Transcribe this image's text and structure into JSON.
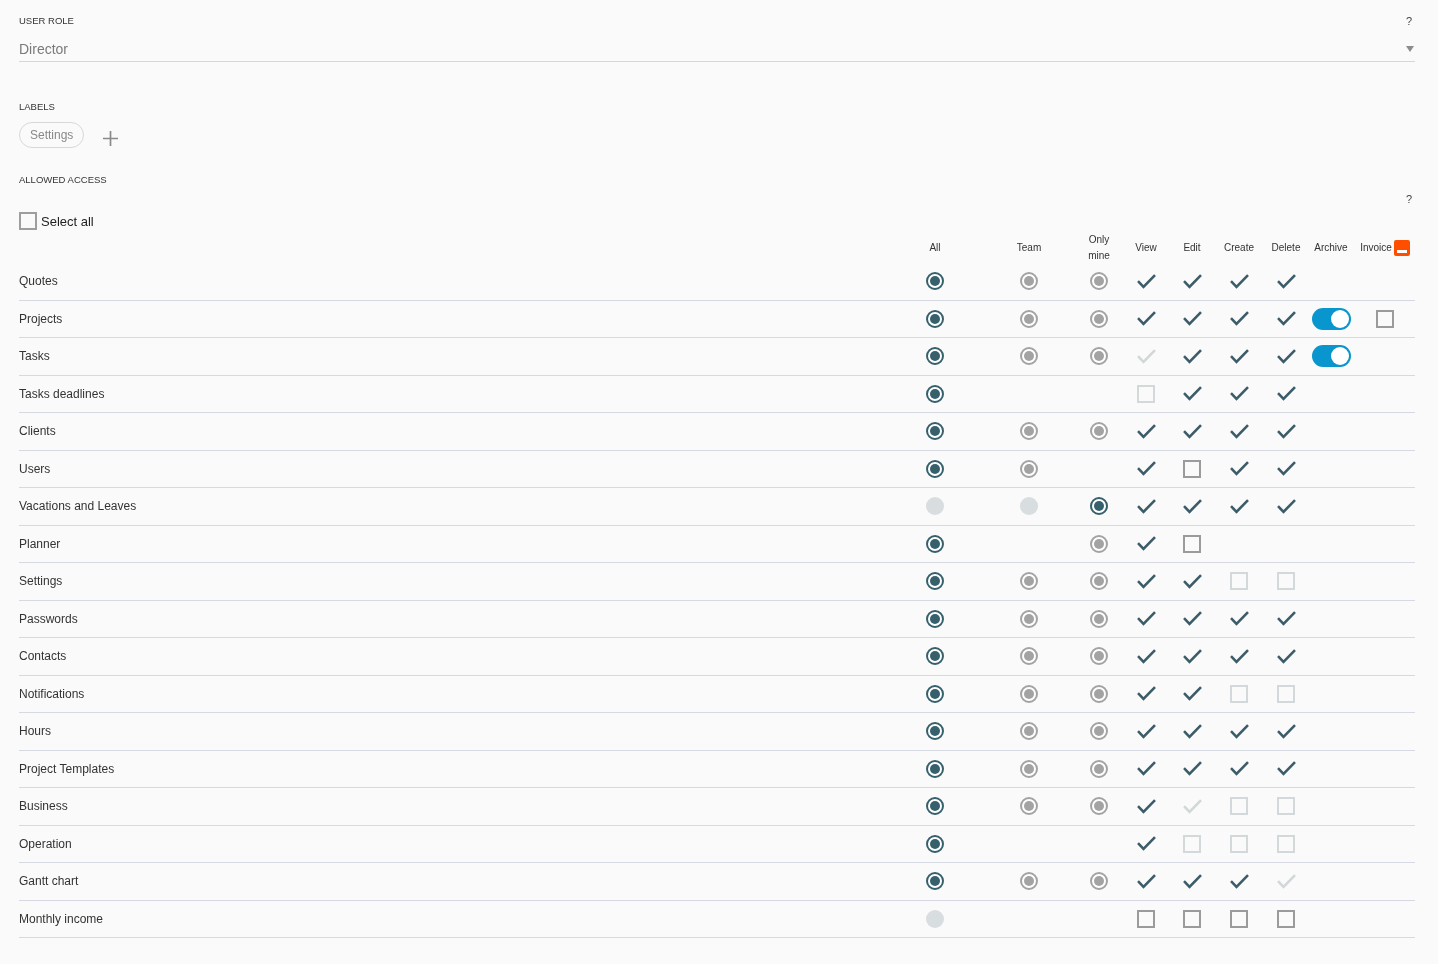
{
  "user_role": {
    "label": "USER ROLE",
    "help": "?",
    "value": "Director"
  },
  "labels": {
    "label": "LABELS",
    "chips": [
      "Settings"
    ]
  },
  "allowed_access": {
    "label": "ALLOWED ACCESS",
    "help": "?",
    "select_all": {
      "label": "Select all",
      "checked": false
    },
    "columns": [
      {
        "label": "All",
        "kind": "radio"
      },
      {
        "label": "Team",
        "kind": "radio"
      },
      {
        "label": "Only mine",
        "kind": "radio"
      },
      {
        "label": "View",
        "kind": "check"
      },
      {
        "label": "Edit",
        "kind": "check"
      },
      {
        "label": "Create",
        "kind": "check"
      },
      {
        "label": "Delete",
        "kind": "check"
      },
      {
        "label": "Archive",
        "kind": "toggle"
      },
      {
        "label": "Invoice",
        "kind": "check",
        "icon": true
      }
    ],
    "rows": [
      {
        "name": "Quotes",
        "cells": [
          {
            "selected": true,
            "disabled": false
          },
          {
            "selected": true,
            "disabled": true
          },
          {
            "selected": true,
            "disabled": true
          },
          {
            "checked": true,
            "disabled": false
          },
          {
            "checked": true,
            "disabled": false
          },
          {
            "checked": true,
            "disabled": false
          },
          {
            "checked": true,
            "disabled": false
          },
          null,
          null
        ]
      },
      {
        "name": "Projects",
        "cells": [
          {
            "selected": true,
            "disabled": false
          },
          {
            "selected": true,
            "disabled": true
          },
          {
            "selected": true,
            "disabled": true
          },
          {
            "checked": true,
            "disabled": false
          },
          {
            "checked": true,
            "disabled": false
          },
          {
            "checked": true,
            "disabled": false
          },
          {
            "checked": true,
            "disabled": false
          },
          {
            "on": true
          },
          {
            "checked": false,
            "disabled": false
          }
        ]
      },
      {
        "name": "Tasks",
        "cells": [
          {
            "selected": true,
            "disabled": false
          },
          {
            "selected": true,
            "disabled": true
          },
          {
            "selected": true,
            "disabled": true
          },
          {
            "checked": true,
            "disabled": true
          },
          {
            "checked": true,
            "disabled": false
          },
          {
            "checked": true,
            "disabled": false
          },
          {
            "checked": true,
            "disabled": false
          },
          {
            "on": true
          },
          null
        ]
      },
      {
        "name": "Tasks deadlines",
        "cells": [
          {
            "selected": true,
            "disabled": false
          },
          null,
          null,
          {
            "checked": false,
            "disabled": true
          },
          {
            "checked": true,
            "disabled": false
          },
          {
            "checked": true,
            "disabled": false
          },
          {
            "checked": true,
            "disabled": false
          },
          null,
          null
        ]
      },
      {
        "name": "Clients",
        "cells": [
          {
            "selected": true,
            "disabled": false
          },
          {
            "selected": true,
            "disabled": true
          },
          {
            "selected": true,
            "disabled": true
          },
          {
            "checked": true,
            "disabled": false
          },
          {
            "checked": true,
            "disabled": false
          },
          {
            "checked": true,
            "disabled": false
          },
          {
            "checked": true,
            "disabled": false
          },
          null,
          null
        ]
      },
      {
        "name": "Users",
        "cells": [
          {
            "selected": true,
            "disabled": false
          },
          {
            "selected": true,
            "disabled": true
          },
          null,
          {
            "checked": true,
            "disabled": false
          },
          {
            "checked": false,
            "disabled": false
          },
          {
            "checked": true,
            "disabled": false
          },
          {
            "checked": true,
            "disabled": false
          },
          null,
          null
        ]
      },
      {
        "name": "Vacations and Leaves",
        "cells": [
          {
            "selected": false,
            "disabled": true
          },
          {
            "selected": false,
            "disabled": true
          },
          {
            "selected": true,
            "disabled": false
          },
          {
            "checked": true,
            "disabled": false
          },
          {
            "checked": true,
            "disabled": false
          },
          {
            "checked": true,
            "disabled": false
          },
          {
            "checked": true,
            "disabled": false
          },
          null,
          null
        ]
      },
      {
        "name": "Planner",
        "cells": [
          {
            "selected": true,
            "disabled": false
          },
          null,
          {
            "selected": true,
            "disabled": true
          },
          {
            "checked": true,
            "disabled": false
          },
          {
            "checked": false,
            "disabled": false
          },
          null,
          null,
          null,
          null
        ]
      },
      {
        "name": "Settings",
        "cells": [
          {
            "selected": true,
            "disabled": false
          },
          {
            "selected": true,
            "disabled": true
          },
          {
            "selected": true,
            "disabled": true
          },
          {
            "checked": true,
            "disabled": false
          },
          {
            "checked": true,
            "disabled": false
          },
          {
            "checked": false,
            "disabled": true
          },
          {
            "checked": false,
            "disabled": true
          },
          null,
          null
        ]
      },
      {
        "name": "Passwords",
        "cells": [
          {
            "selected": true,
            "disabled": false
          },
          {
            "selected": true,
            "disabled": true
          },
          {
            "selected": true,
            "disabled": true
          },
          {
            "checked": true,
            "disabled": false
          },
          {
            "checked": true,
            "disabled": false
          },
          {
            "checked": true,
            "disabled": false
          },
          {
            "checked": true,
            "disabled": false
          },
          null,
          null
        ]
      },
      {
        "name": "Contacts",
        "cells": [
          {
            "selected": true,
            "disabled": false
          },
          {
            "selected": true,
            "disabled": true
          },
          {
            "selected": true,
            "disabled": true
          },
          {
            "checked": true,
            "disabled": false
          },
          {
            "checked": true,
            "disabled": false
          },
          {
            "checked": true,
            "disabled": false
          },
          {
            "checked": true,
            "disabled": false
          },
          null,
          null
        ]
      },
      {
        "name": "Notifications",
        "cells": [
          {
            "selected": true,
            "disabled": false
          },
          {
            "selected": true,
            "disabled": true
          },
          {
            "selected": true,
            "disabled": true
          },
          {
            "checked": true,
            "disabled": false
          },
          {
            "checked": true,
            "disabled": false
          },
          {
            "checked": false,
            "disabled": true
          },
          {
            "checked": false,
            "disabled": true
          },
          null,
          null
        ]
      },
      {
        "name": "Hours",
        "cells": [
          {
            "selected": true,
            "disabled": false
          },
          {
            "selected": true,
            "disabled": true
          },
          {
            "selected": true,
            "disabled": true
          },
          {
            "checked": true,
            "disabled": false
          },
          {
            "checked": true,
            "disabled": false
          },
          {
            "checked": true,
            "disabled": false
          },
          {
            "checked": true,
            "disabled": false
          },
          null,
          null
        ]
      },
      {
        "name": "Project Templates",
        "cells": [
          {
            "selected": true,
            "disabled": false
          },
          {
            "selected": true,
            "disabled": true
          },
          {
            "selected": true,
            "disabled": true
          },
          {
            "checked": true,
            "disabled": false
          },
          {
            "checked": true,
            "disabled": false
          },
          {
            "checked": true,
            "disabled": false
          },
          {
            "checked": true,
            "disabled": false
          },
          null,
          null
        ]
      },
      {
        "name": "Business",
        "cells": [
          {
            "selected": true,
            "disabled": false
          },
          {
            "selected": true,
            "disabled": true
          },
          {
            "selected": true,
            "disabled": true
          },
          {
            "checked": true,
            "disabled": false
          },
          {
            "checked": true,
            "disabled": true
          },
          {
            "checked": false,
            "disabled": true
          },
          {
            "checked": false,
            "disabled": true
          },
          null,
          null
        ]
      },
      {
        "name": "Operation",
        "cells": [
          {
            "selected": true,
            "disabled": false
          },
          null,
          null,
          {
            "checked": true,
            "disabled": false
          },
          {
            "checked": false,
            "disabled": true
          },
          {
            "checked": false,
            "disabled": true
          },
          {
            "checked": false,
            "disabled": true
          },
          null,
          null
        ]
      },
      {
        "name": "Gantt chart",
        "cells": [
          {
            "selected": true,
            "disabled": false
          },
          {
            "selected": true,
            "disabled": true
          },
          {
            "selected": true,
            "disabled": true
          },
          {
            "checked": true,
            "disabled": false
          },
          {
            "checked": true,
            "disabled": false
          },
          {
            "checked": true,
            "disabled": false
          },
          {
            "checked": true,
            "disabled": true
          },
          null,
          null
        ]
      },
      {
        "name": "Monthly income",
        "cells": [
          {
            "selected": false,
            "disabled": true
          },
          null,
          null,
          {
            "checked": false,
            "disabled": false
          },
          {
            "checked": false,
            "disabled": false
          },
          {
            "checked": false,
            "disabled": false
          },
          {
            "checked": false,
            "disabled": false
          },
          null,
          null
        ]
      }
    ]
  }
}
